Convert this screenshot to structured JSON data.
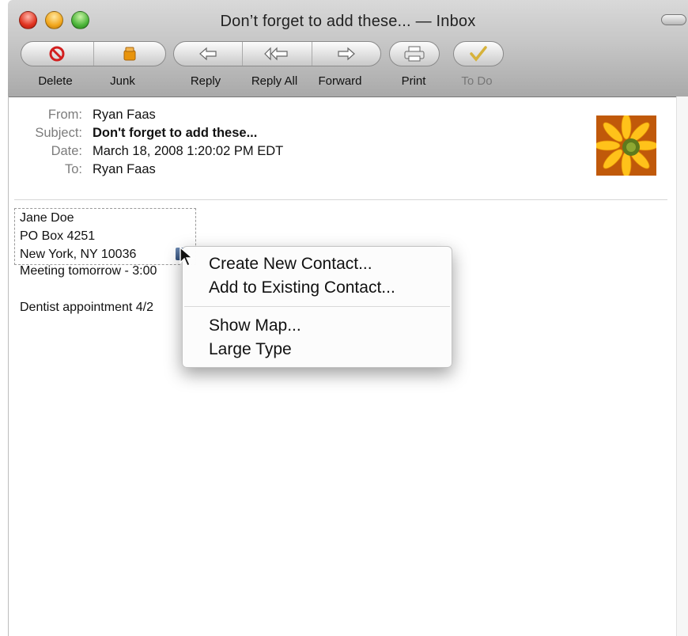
{
  "window": {
    "title": "Don’t forget to add these... — Inbox"
  },
  "toolbar": {
    "delete": "Delete",
    "junk": "Junk",
    "reply": "Reply",
    "reply_all": "Reply All",
    "forward": "Forward",
    "print": "Print",
    "todo": "To Do"
  },
  "header": {
    "from_label": "From:",
    "from_value": "Ryan Faas",
    "subject_label": "Subject:",
    "subject_value": "Don't forget to add these...",
    "date_label": "Date:",
    "date_value": "March 18, 2008 1:20:02 PM EDT",
    "to_label": "To:",
    "to_value": "Ryan Faas"
  },
  "body": {
    "line1": "Jane Doe",
    "line2": "PO Box 4251",
    "line3": "New York, NY 10036",
    "line4": "Meeting tomorrow - 3:00",
    "line5": "Dentist appointment 4/2"
  },
  "context_menu": {
    "items": [
      "Create New Contact...",
      "Add to Existing Contact...",
      "Show Map...",
      "Large Type"
    ]
  },
  "colors": {
    "delete_red": "#d21f1f",
    "junk_orange": "#e8940c",
    "todo_check": "#d6b23a"
  }
}
